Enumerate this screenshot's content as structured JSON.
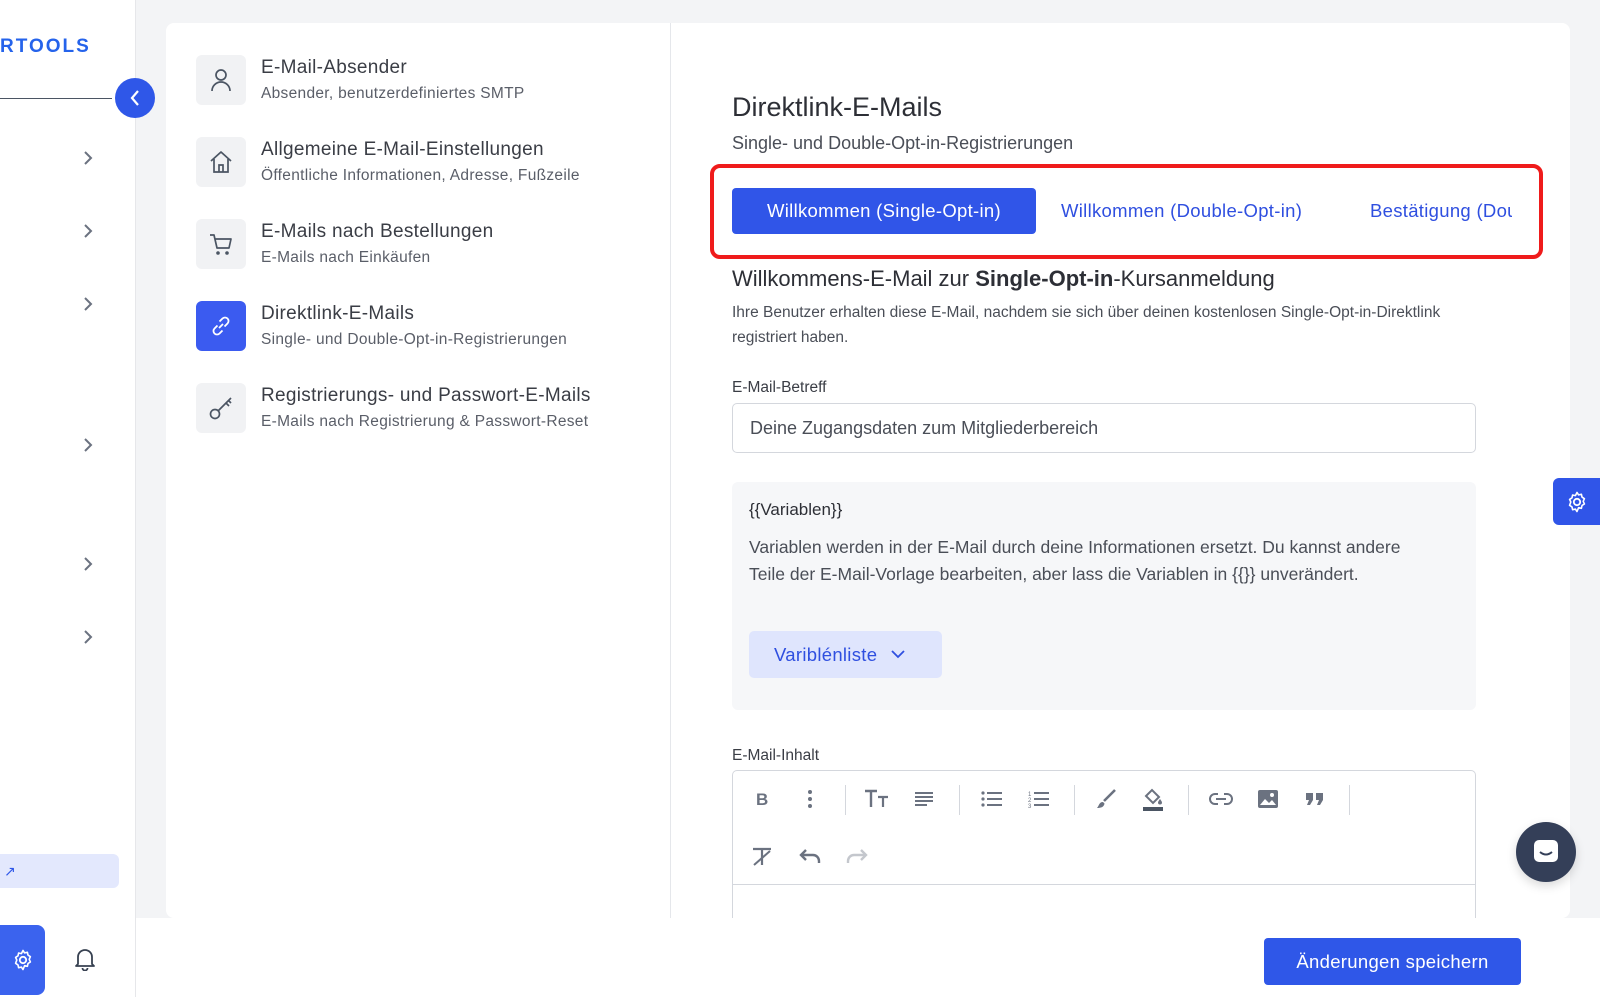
{
  "sidebar": {
    "brand": "RTOOLS",
    "external_link_label": "↗",
    "chevron_count": 6
  },
  "menu": {
    "items": [
      {
        "title": "E-Mail-Absender",
        "subtitle": "Absender, benutzerdefiniertes SMTP",
        "icon": "user-icon",
        "active": false
      },
      {
        "title": "Allgemeine E-Mail-Einstellungen",
        "subtitle": "Öffentliche Informationen, Adresse, Fußzeile",
        "icon": "home-icon",
        "active": false
      },
      {
        "title": "E-Mails nach Bestellungen",
        "subtitle": "E-Mails nach Einkäufen",
        "icon": "cart-icon",
        "active": false
      },
      {
        "title": "Direktlink-E-Mails",
        "subtitle": "Single- und Double-Opt-in-Registrierungen",
        "icon": "link-icon",
        "active": true
      },
      {
        "title": "Registrierungs- und Passwort-E-Mails",
        "subtitle": "E-Mails nach Registrierung & Passwort-Reset",
        "icon": "key-icon",
        "active": false
      }
    ]
  },
  "content": {
    "title": "Direktlink-E-Mails",
    "subtitle": "Single- und Double-Opt-in-Registrierungen",
    "tabs": [
      {
        "label": "Willkommen (Single-Opt-in)",
        "active": true
      },
      {
        "label": "Willkommen (Double-Opt-in)",
        "active": false
      },
      {
        "label": "Bestätigung (Double-Opt-in)",
        "active": false
      }
    ],
    "section_title_pre": "Willkommens-E-Mail zur ",
    "section_title_bold": "Single-Opt-in",
    "section_title_post": "-Kursanmeldung",
    "section_desc": "Ihre Benutzer erhalten diese E-Mail, nachdem sie sich über deinen kostenlosen Single-Opt-in-Direktlink registriert haben.",
    "subject_label": "E-Mail-Betreff",
    "subject_value": "Deine Zugangsdaten zum Mitgliederbereich",
    "variables_title": "{{Variablen}}",
    "variables_text": "Variablen werden in der E-Mail durch deine Informationen ersetzt. Du kannst andere Teile der E-Mail-Vorlage bearbeiten, aber lass die Variablen in {{}} unverändert.",
    "variables_button": "Variblénliste",
    "body_label": "E-Mail-Inhalt"
  },
  "footer": {
    "save_label": "Änderungen speichern"
  },
  "colors": {
    "accent": "#3055e8",
    "highlight_border": "#ef1b1b",
    "sidebar_bg": "#ffffff",
    "page_bg": "#f3f4f6"
  }
}
